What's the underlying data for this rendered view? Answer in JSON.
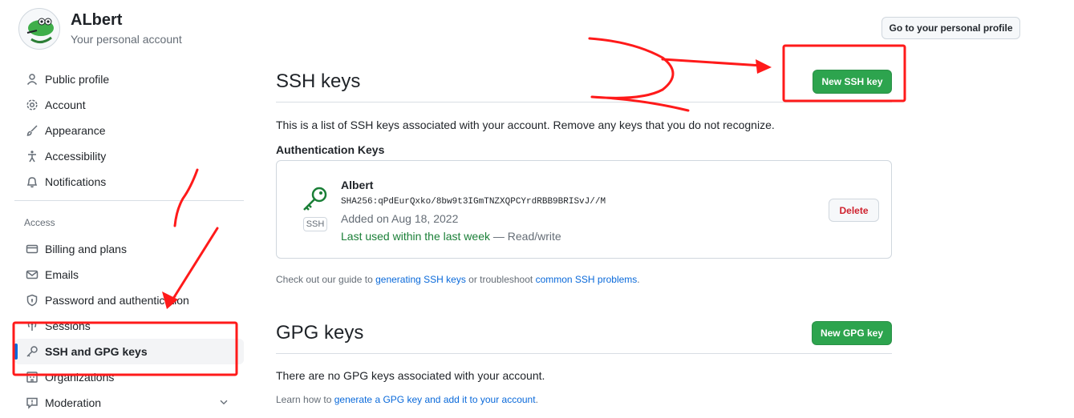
{
  "user": {
    "name": "ALbert",
    "subtitle": "Your personal account"
  },
  "header": {
    "profile_button": "Go to your personal profile"
  },
  "sidebar": {
    "items": [
      {
        "label": "Public profile",
        "icon": "person-icon"
      },
      {
        "label": "Account",
        "icon": "gear-icon"
      },
      {
        "label": "Appearance",
        "icon": "paintbrush-icon"
      },
      {
        "label": "Accessibility",
        "icon": "accessibility-icon"
      },
      {
        "label": "Notifications",
        "icon": "bell-icon"
      }
    ],
    "access_heading": "Access",
    "access_items": [
      {
        "label": "Billing and plans",
        "icon": "credit-card-icon"
      },
      {
        "label": "Emails",
        "icon": "mail-icon"
      },
      {
        "label": "Password and authentication",
        "icon": "shield-icon"
      },
      {
        "label": "Sessions",
        "icon": "broadcast-icon"
      },
      {
        "label": "SSH and GPG keys",
        "icon": "key-icon",
        "active": true
      },
      {
        "label": "Organizations",
        "icon": "organization-icon"
      },
      {
        "label": "Moderation",
        "icon": "report-icon"
      }
    ]
  },
  "ssh": {
    "title": "SSH keys",
    "new_button": "New SSH key",
    "description": "This is a list of SSH keys associated with your account. Remove any keys that you do not recognize.",
    "auth_heading": "Authentication Keys",
    "key": {
      "name": "Albert",
      "fingerprint": "SHA256:qPdEurQxko/8bw9t3IGmTNZXQPCYrdRBB9BRISvJ//M",
      "added": "Added on Aug 18, 2022",
      "last_used": "Last used within the last week",
      "access": "— Read/write",
      "badge": "SSH",
      "delete_button": "Delete"
    },
    "guide": {
      "prefix": "Check out our guide to",
      "link1": "generating SSH keys",
      "middle": "or troubleshoot",
      "link2": "common SSH problems",
      "suffix": "."
    }
  },
  "gpg": {
    "title": "GPG keys",
    "new_button": "New GPG key",
    "empty": "There are no GPG keys associated with your account.",
    "learn": {
      "prefix": "Learn how to",
      "link": "generate a GPG key and add it to your account",
      "suffix": "."
    }
  },
  "colors": {
    "accent": "#0969da",
    "primary_green": "#2da44e",
    "danger": "#cf222e",
    "annotation_red": "#ff1a1a",
    "success_text": "#1a7f37"
  }
}
